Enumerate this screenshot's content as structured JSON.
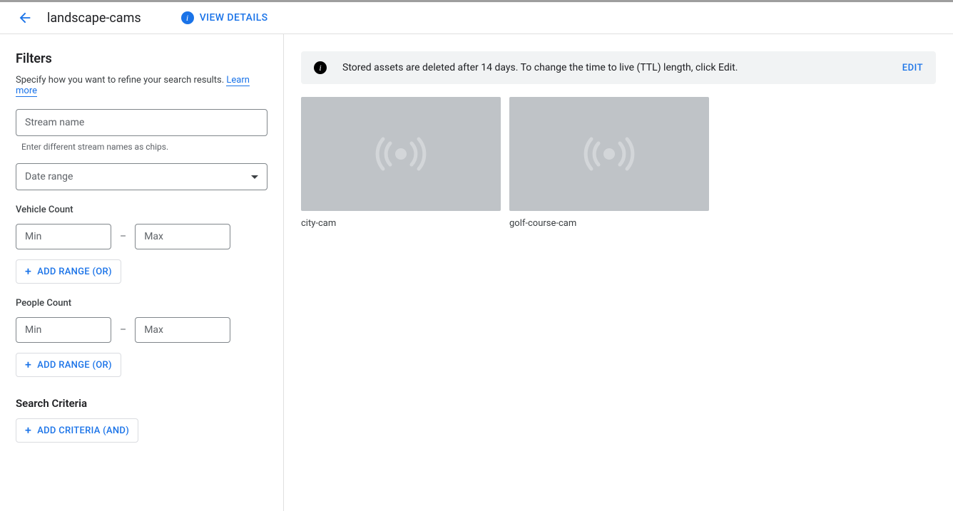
{
  "header": {
    "title": "landscape-cams",
    "view_details": "VIEW DETAILS"
  },
  "filters": {
    "title": "Filters",
    "description": "Specify how you want to refine your search results.",
    "learn_more": "Learn more",
    "stream_name_placeholder": "Stream name",
    "stream_name_helper": "Enter different stream names as chips.",
    "date_range_placeholder": "Date range",
    "vehicle": {
      "label": "Vehicle Count",
      "min": "Min",
      "max": "Max",
      "add_range": "ADD RANGE (OR)"
    },
    "people": {
      "label": "People Count",
      "min": "Min",
      "max": "Max",
      "add_range": "ADD RANGE (OR)"
    },
    "search_criteria": {
      "label": "Search Criteria",
      "add_criteria": "ADD CRITERIA (AND)"
    }
  },
  "banner": {
    "text": "Stored assets are deleted after 14 days. To change the time to live (TTL) length, click Edit.",
    "edit": "EDIT"
  },
  "streams": [
    {
      "name": "city-cam"
    },
    {
      "name": "golf-course-cam"
    }
  ]
}
